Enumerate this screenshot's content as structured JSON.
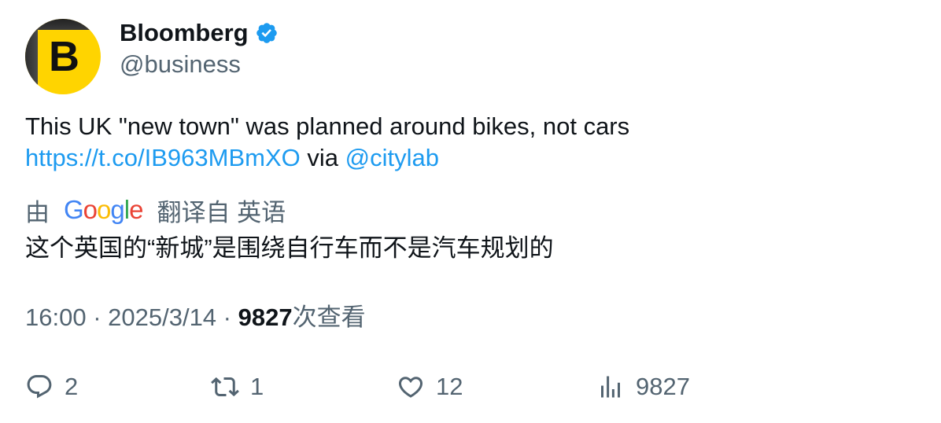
{
  "author": {
    "avatar_letter": "B",
    "display_name": "Bloomberg",
    "handle": "@business",
    "verified_icon": "verified-badge-icon"
  },
  "tweet": {
    "text_line1": "This UK \"new town\" was planned around bikes, not cars",
    "link_url": "https://t.co/IB963MBmXO",
    "via": " via ",
    "mention": "@citylab"
  },
  "translation": {
    "by_label": "由",
    "google_logo": [
      "G",
      "o",
      "o",
      "g",
      "l",
      "e"
    ],
    "from_label": "翻译自 英语",
    "translated_text": "这个英国的“新城”是围绕自行车而不是汽车规划的"
  },
  "meta": {
    "time": "16:00",
    "separator": " · ",
    "date": "2025/3/14",
    "views_count": "9827",
    "views_label": "次查看"
  },
  "actions": {
    "replies": "2",
    "retweets": "1",
    "likes": "12",
    "views": "9827"
  },
  "colors": {
    "link": "#1d9bf0",
    "secondary_text": "#536471",
    "primary_text": "#0f1419",
    "avatar_bg": "#ffd400",
    "google_blue": "#4285F4",
    "google_red": "#EA4335",
    "google_yellow": "#FBBC05",
    "google_green": "#34A853"
  }
}
